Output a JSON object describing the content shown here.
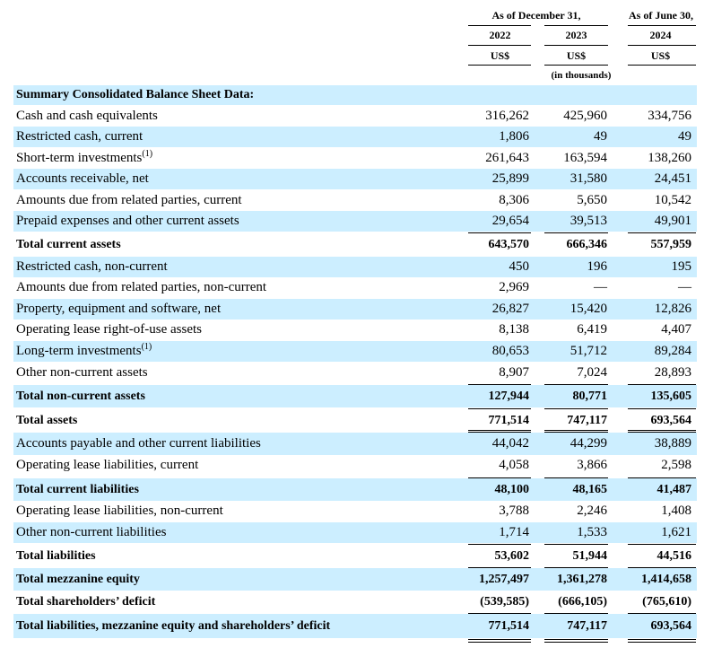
{
  "header": {
    "group1_title": "As of December 31,",
    "group2_title": "As of June 30,",
    "years": [
      "2022",
      "2023",
      "2024"
    ],
    "currency": [
      "US$",
      "US$",
      "US$"
    ],
    "units": "(in thousands)"
  },
  "section_title": "Summary Consolidated Balance Sheet Data:",
  "rows": [
    {
      "label": "Cash and cash equivalents",
      "note": "",
      "values": [
        "316,262",
        "425,960",
        "334,756"
      ]
    },
    {
      "label": "Restricted cash, current",
      "note": "",
      "values": [
        "1,806",
        "49",
        "49"
      ]
    },
    {
      "label": "Short-term investments",
      "note": "(1)",
      "values": [
        "261,643",
        "163,594",
        "138,260"
      ]
    },
    {
      "label": "Accounts receivable, net",
      "note": "",
      "values": [
        "25,899",
        "31,580",
        "24,451"
      ]
    },
    {
      "label": "Amounts due from related parties, current",
      "note": "",
      "values": [
        "8,306",
        "5,650",
        "10,542"
      ]
    },
    {
      "label": "Prepaid expenses and other current assets",
      "note": "",
      "values": [
        "29,654",
        "39,513",
        "49,901"
      ]
    },
    {
      "label": "Total current assets",
      "note": "",
      "values": [
        "643,570",
        "666,346",
        "557,959"
      ]
    },
    {
      "label": "Restricted cash, non-current",
      "note": "",
      "values": [
        "450",
        "196",
        "195"
      ]
    },
    {
      "label": "Amounts due from related parties, non-current",
      "note": "",
      "values": [
        "2,969",
        "—",
        "—"
      ]
    },
    {
      "label": "Property, equipment and software, net",
      "note": "",
      "values": [
        "26,827",
        "15,420",
        "12,826"
      ]
    },
    {
      "label": "Operating lease right-of-use assets",
      "note": "",
      "values": [
        "8,138",
        "6,419",
        "4,407"
      ]
    },
    {
      "label": "Long-term investments",
      "note": "(1)",
      "values": [
        "80,653",
        "51,712",
        "89,284"
      ]
    },
    {
      "label": "Other non-current assets",
      "note": "",
      "values": [
        "8,907",
        "7,024",
        "28,893"
      ]
    },
    {
      "label": "Total non-current assets",
      "note": "",
      "values": [
        "127,944",
        "80,771",
        "135,605"
      ]
    },
    {
      "label": "Total assets",
      "note": "",
      "values": [
        "771,514",
        "747,117",
        "693,564"
      ]
    },
    {
      "label": "Accounts payable and other current liabilities",
      "note": "",
      "values": [
        "44,042",
        "44,299",
        "38,889"
      ]
    },
    {
      "label": "Operating lease liabilities, current",
      "note": "",
      "values": [
        "4,058",
        "3,866",
        "2,598"
      ]
    },
    {
      "label": "Total current liabilities",
      "note": "",
      "values": [
        "48,100",
        "48,165",
        "41,487"
      ]
    },
    {
      "label": "Operating lease liabilities, non-current",
      "note": "",
      "values": [
        "3,788",
        "2,246",
        "1,408"
      ]
    },
    {
      "label": "Other non-current liabilities",
      "note": "",
      "values": [
        "1,714",
        "1,533",
        "1,621"
      ]
    },
    {
      "label": "Total liabilities",
      "note": "",
      "values": [
        "53,602",
        "51,944",
        "44,516"
      ]
    },
    {
      "label": "Total mezzanine equity",
      "note": "",
      "values": [
        "1,257,497",
        "1,361,278",
        "1,414,658"
      ]
    },
    {
      "label": "Total shareholders’ deficit",
      "note": "",
      "values": [
        "(539,585)",
        "(666,105)",
        "(765,610)"
      ]
    },
    {
      "label": "Total liabilities, mezzanine equity and shareholders’ deficit",
      "note": "",
      "values": [
        "771,514",
        "747,117",
        "693,564"
      ]
    }
  ]
}
